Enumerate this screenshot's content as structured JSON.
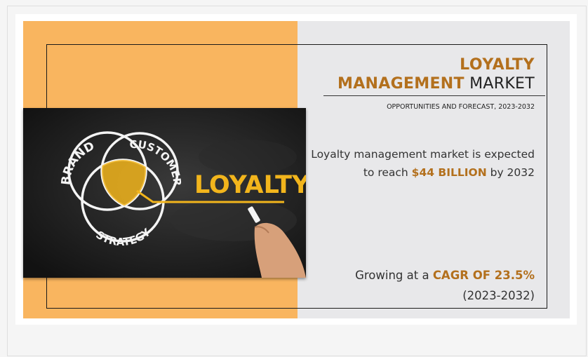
{
  "title": {
    "line1": "LOYALTY",
    "line2_highlight": "MANAGEMENT",
    "line2_rest": " MARKET"
  },
  "subtitle": "OPPORTUNITIES AND FORECAST, 2023-2032",
  "description": {
    "part1": "Loyalty management market is expected to reach ",
    "highlight": "$44 BILLION",
    "part2": " by 2032"
  },
  "growth": {
    "part1": "Growing at a ",
    "highlight": "CAGR OF 23.5%",
    "period": "(2023-2032)"
  },
  "image": {
    "circle_labels": [
      "BRAND",
      "CUSTOMER",
      "STRATEGY"
    ],
    "chalk_word": "LOYALTY"
  },
  "colors": {
    "accent": "#b3701d",
    "orange_panel": "#f9b55f",
    "grey_panel": "#e8e8ea",
    "chalk_yellow": "#f2b51c"
  }
}
